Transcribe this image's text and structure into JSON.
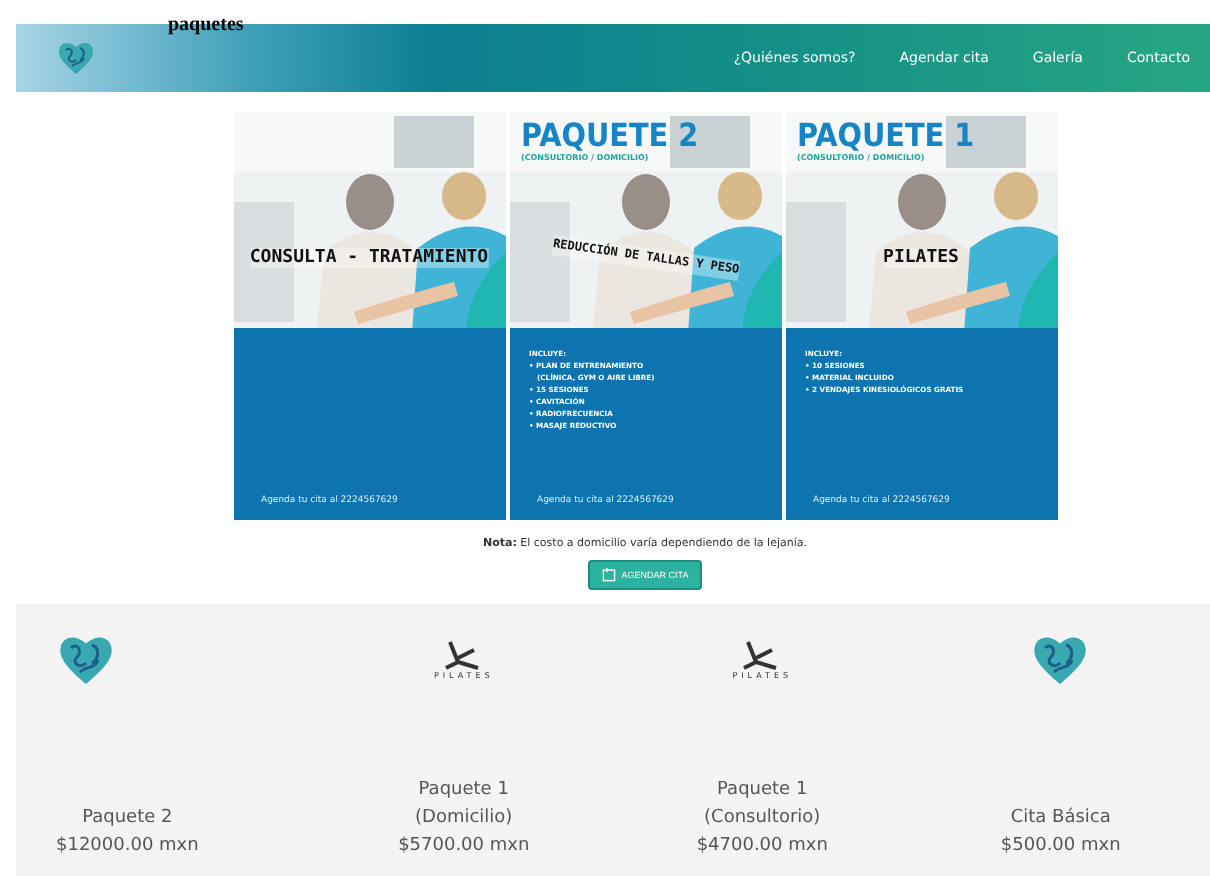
{
  "page_heading": "paquetes",
  "nav": {
    "links": [
      {
        "label": "¿Quiénes somos?"
      },
      {
        "label": "Agendar cita"
      },
      {
        "label": "Galería"
      },
      {
        "label": "Contacto"
      }
    ]
  },
  "posters": [
    {
      "banner": "CONSULTA - TRATAMIENTO",
      "phone": "Agenda tu cita al 2224567629"
    },
    {
      "title": "PAQUETE 2",
      "subtitle": "(CONSULTORIO / DOMICILIO)",
      "banner": "REDUCCIÓN DE TALLAS Y PESO",
      "includes_heading": "INCLUYE:",
      "includes": [
        "• PLAN DE ENTRENAMIENTO",
        "(CLÍNICA, GYM O AIRE LIBRE)",
        "• 15 SESIONES",
        "• CAVITACIÓN",
        "• RADIOFRECUENCIA",
        "• MASAJE REDUCTIVO"
      ],
      "phone": "Agenda tu cita al 2224567629"
    },
    {
      "title": "PAQUETE 1",
      "subtitle": "(CONSULTORIO / DOMICILIO)",
      "banner": "PILATES",
      "includes_heading": "INCLUYE:",
      "includes": [
        "• 10 SESIONES",
        "• MATERIAL INCLUIDO",
        "• 2 VENDAJES KINESIOLÓGICOS GRATIS"
      ],
      "phone": "Agenda tu cita al 2224567629"
    }
  ],
  "note": "**Nota:** El costo a domicilio varía dependiendo de la lejanía.",
  "cta": {
    "label": "AGENDAR CITA"
  },
  "packages": [
    {
      "kind": "heart",
      "name_lines": [
        "Paquete 2"
      ],
      "price": "$12000.00 mxn"
    },
    {
      "kind": "pilates",
      "logo_text": "PILATES",
      "name_lines": [
        "Paquete 1",
        "(Domicilio)"
      ],
      "price": "$5700.00 mxn"
    },
    {
      "kind": "pilates",
      "logo_text": "PILATES",
      "name_lines": [
        "Paquete 1",
        "(Consultorio)"
      ],
      "price": "$4700.00 mxn"
    },
    {
      "kind": "heart",
      "name_lines": [
        "Cita Básica"
      ],
      "price": "$500.00 mxn"
    }
  ]
}
